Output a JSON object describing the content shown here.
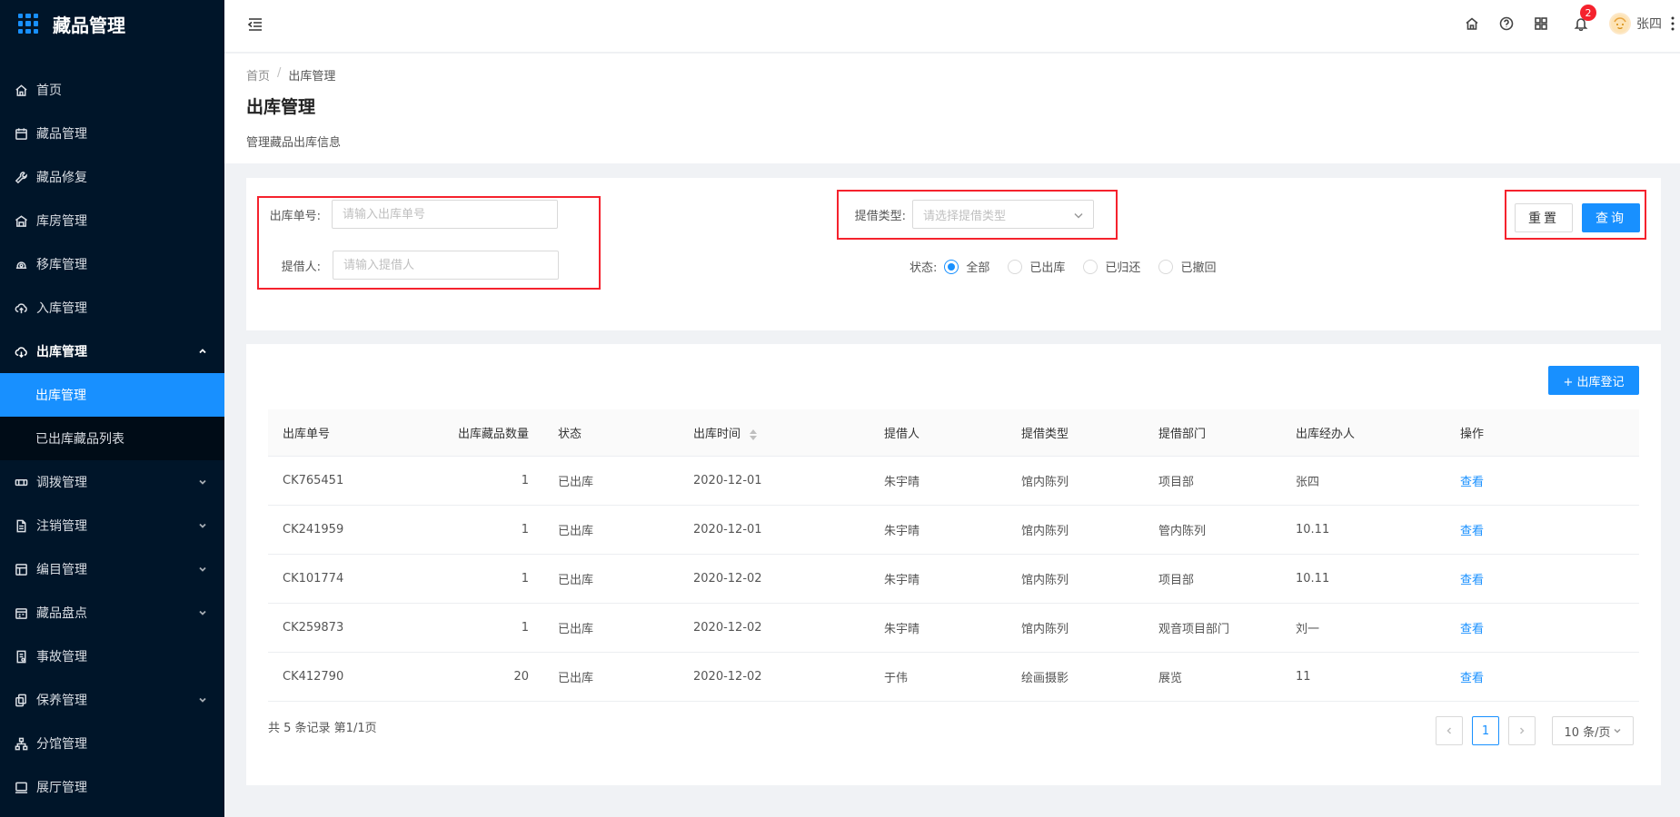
{
  "app": {
    "title": "藏品管理"
  },
  "sidebar": {
    "items": [
      {
        "label": "首页",
        "icon": "home-icon"
      },
      {
        "label": "藏品管理",
        "icon": "calendar-icon"
      },
      {
        "label": "藏品修复",
        "icon": "wrench-icon"
      },
      {
        "label": "库房管理",
        "icon": "warehouse-icon"
      },
      {
        "label": "移库管理",
        "icon": "transfer-icon"
      },
      {
        "label": "入库管理",
        "icon": "cloud-upload-icon"
      },
      {
        "label": "出库管理",
        "icon": "cloud-download-icon",
        "expanded": true
      },
      {
        "label": "调拨管理",
        "icon": "allocate-icon"
      },
      {
        "label": "注销管理",
        "icon": "document-icon"
      },
      {
        "label": "编目管理",
        "icon": "catalog-icon"
      },
      {
        "label": "藏品盘点",
        "icon": "inventory-icon"
      },
      {
        "label": "事故管理",
        "icon": "incident-icon"
      },
      {
        "label": "保养管理",
        "icon": "maintenance-icon"
      },
      {
        "label": "分馆管理",
        "icon": "branch-icon"
      },
      {
        "label": "展厅管理",
        "icon": "monitor-icon"
      }
    ],
    "submenu": [
      {
        "label": "出库管理",
        "active": true
      },
      {
        "label": "已出库藏品列表",
        "active": false
      }
    ]
  },
  "header": {
    "notification_count": "2",
    "user_name": "张四"
  },
  "page": {
    "breadcrumb": [
      "首页",
      "/",
      "出库管理"
    ],
    "title": "出库管理",
    "description": "管理藏品出库信息"
  },
  "filters": {
    "order_no_label": "出库单号:",
    "order_no_placeholder": "请输入出库单号",
    "borrower_label": "提借人:",
    "borrower_placeholder": "请输入提借人",
    "type_label": "提借类型:",
    "type_placeholder": "请选择提借类型",
    "status_label": "状态:",
    "status_options": [
      "全部",
      "已出库",
      "已归还",
      "已撤回"
    ],
    "status_selected": "全部",
    "reset_label": "重置",
    "query_label": "查询"
  },
  "table": {
    "add_label": "+ 出库登记",
    "columns": [
      "出库单号",
      "出库藏品数量",
      "状态",
      "出库时间",
      "提借人",
      "提借类型",
      "提借部门",
      "出库经办人",
      "操作"
    ],
    "rows": [
      [
        "CK765451",
        "1",
        "已出库",
        "2020-12-01",
        "朱宇晴",
        "馆内陈列",
        "项目部",
        "张四",
        "查看"
      ],
      [
        "CK241959",
        "1",
        "已出库",
        "2020-12-01",
        "朱宇晴",
        "馆内陈列",
        "管内陈列",
        "10.11",
        "查看"
      ],
      [
        "CK101774",
        "1",
        "已出库",
        "2020-12-02",
        "朱宇晴",
        "馆内陈列",
        "项目部",
        "10.11",
        "查看"
      ],
      [
        "CK259873",
        "1",
        "已出库",
        "2020-12-02",
        "朱宇晴",
        "馆内陈列",
        "观音项目部门",
        "刘一",
        "查看"
      ],
      [
        "CK412790",
        "20",
        "已出库",
        "2020-12-02",
        "于伟",
        "绘画摄影",
        "展览",
        "11",
        "查看"
      ]
    ],
    "total_text": "共 5 条记录 第1/1页",
    "current_page": "1",
    "page_size": "10 条/页"
  },
  "colors": {
    "primary": "#1890ff",
    "sidebar_bg": "#001529",
    "highlight": "#f5222d"
  }
}
